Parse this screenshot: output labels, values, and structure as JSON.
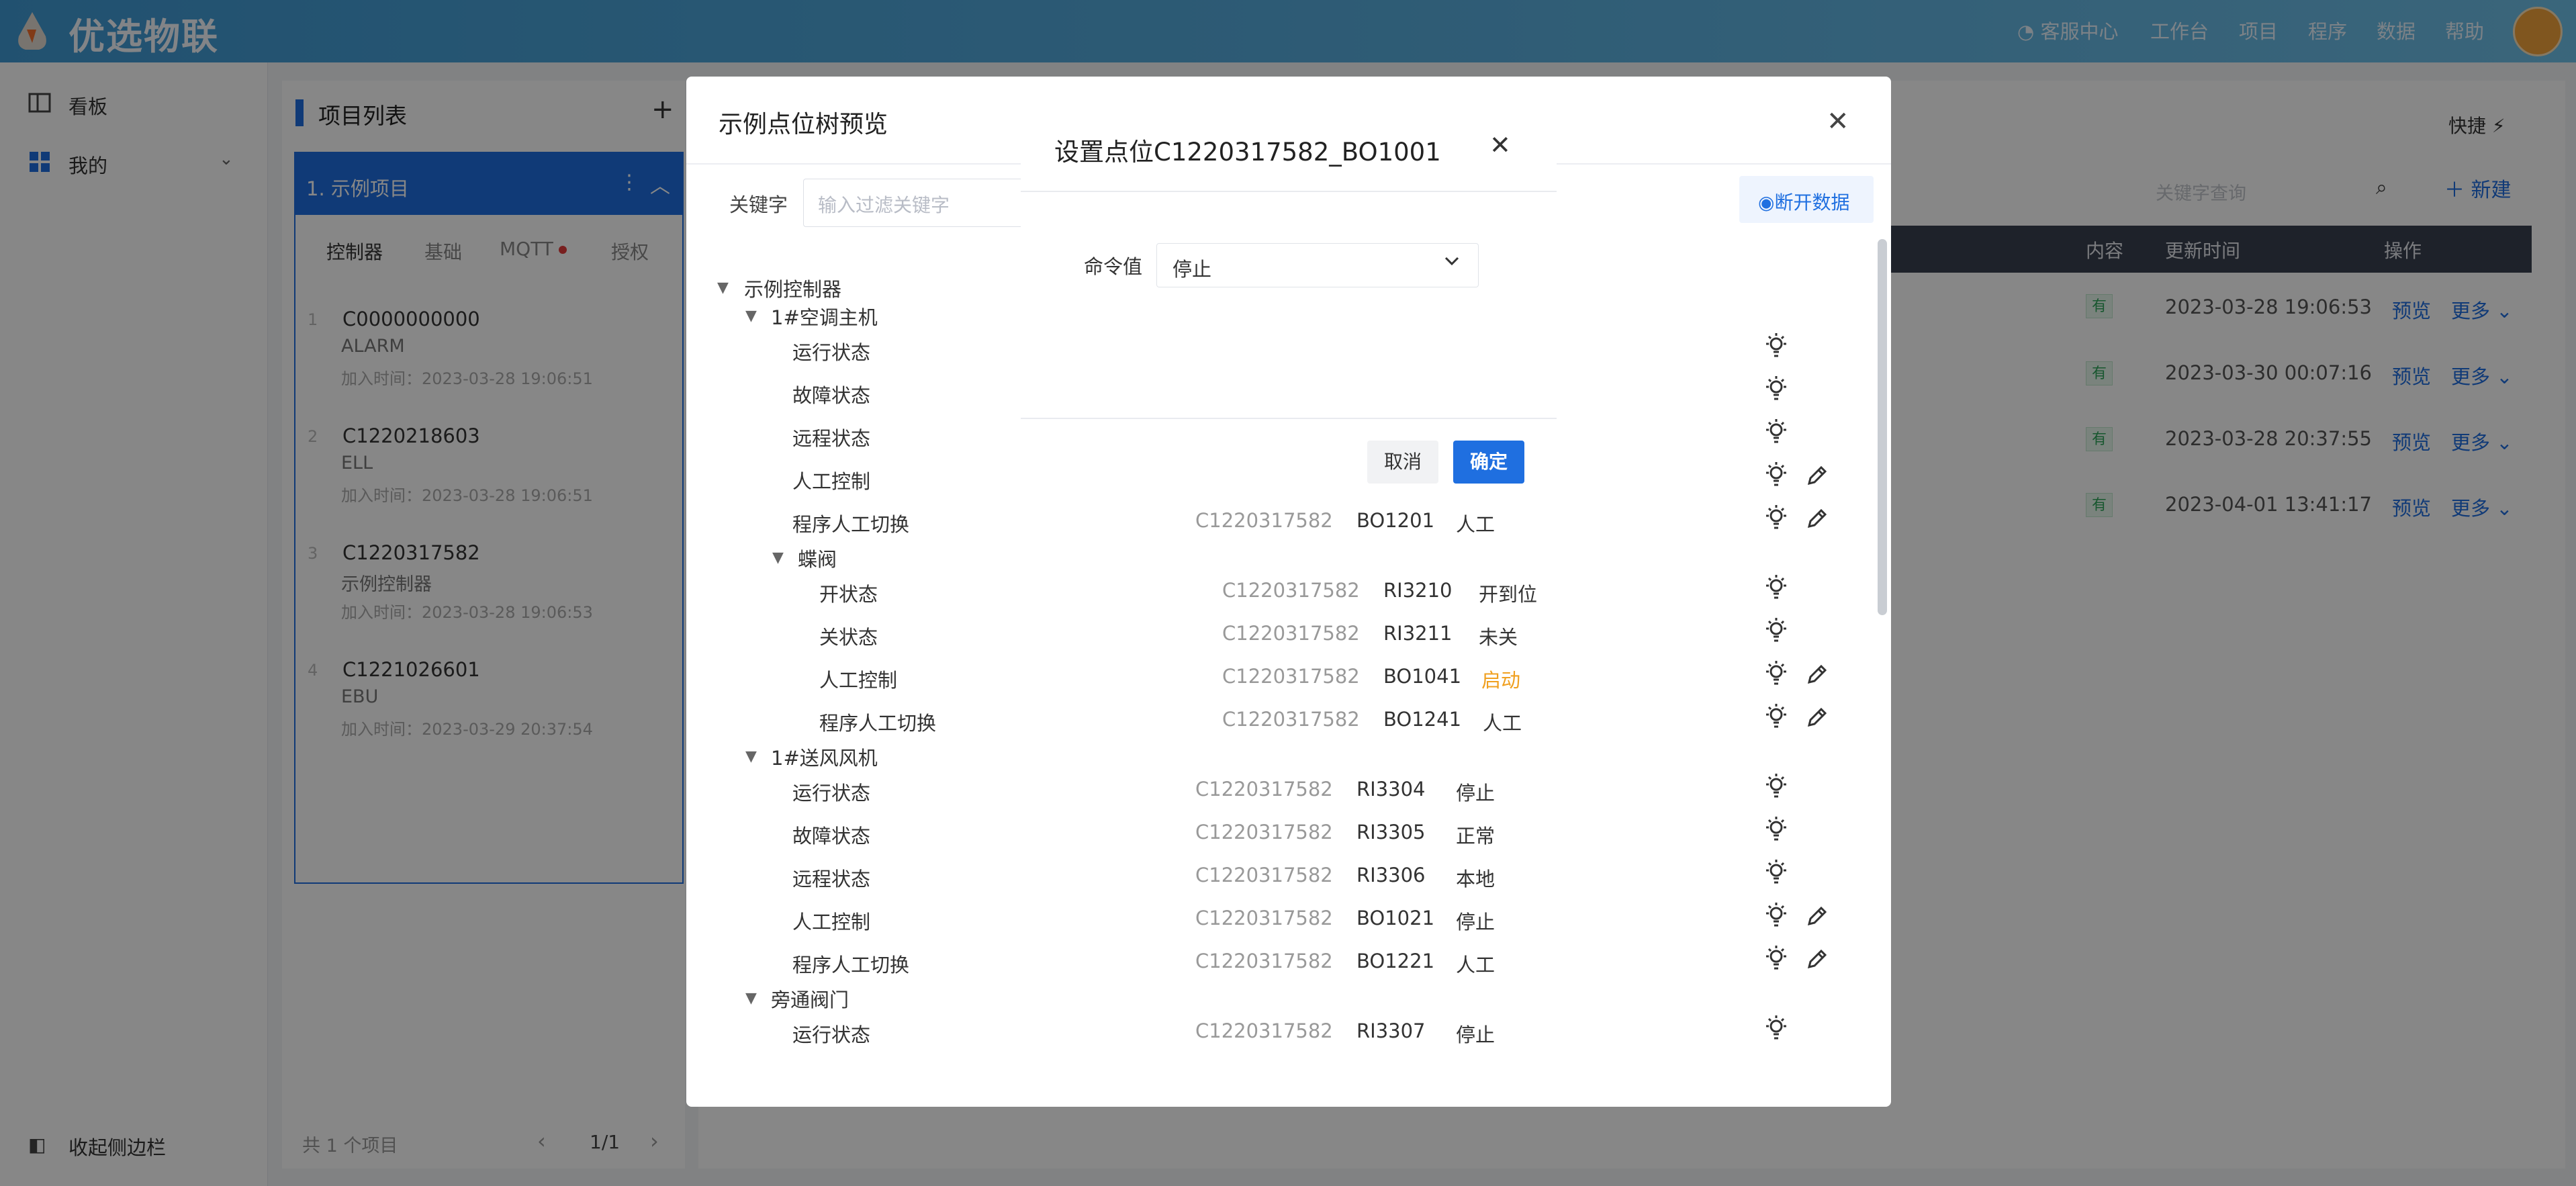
{
  "brand": {
    "name": "优选物联"
  },
  "nav": {
    "items": [
      "客服中心",
      "工作台",
      "项目",
      "程序",
      "数据",
      "帮助"
    ]
  },
  "sidebar": {
    "items": [
      "看板",
      "我的"
    ],
    "collapse_label": "收起侧边栏"
  },
  "project_list": {
    "title": "项目列表",
    "active_project": "1. 示例项目",
    "tabs": [
      "控制器",
      "基础",
      "MQTT",
      "授权"
    ],
    "items": [
      {
        "no": "1",
        "code": "C0000000000",
        "sub": "ALARM",
        "time": "加入时间：2023-03-28 19:06:51"
      },
      {
        "no": "2",
        "code": "C1220218603",
        "sub": "ELL",
        "time": "加入时间：2023-03-28 19:06:51"
      },
      {
        "no": "3",
        "code": "C1220317582",
        "sub": "示例控制器",
        "time": "加入时间：2023-03-28 19:06:53"
      },
      {
        "no": "4",
        "code": "C1221026601",
        "sub": "EBU",
        "time": "加入时间：2023-03-29 20:37:54"
      }
    ],
    "footer_count": "共 1 个项目",
    "pagination": "1/1"
  },
  "main": {
    "quick_label": "快捷",
    "search_placeholder": "关键字查询",
    "new_label": "新建",
    "headers": [
      "内容",
      "更新时间",
      "操作"
    ],
    "rows": [
      {
        "tag": "有",
        "time": "2023-03-28 19:06:53",
        "preview": "预览",
        "more": "更多"
      },
      {
        "tag": "有",
        "time": "2023-03-30 00:07:16",
        "preview": "预览",
        "more": "更多"
      },
      {
        "tag": "有",
        "time": "2023-03-28 20:37:55",
        "preview": "预览",
        "more": "更多"
      },
      {
        "tag": "有",
        "time": "2023-04-01 13:41:17",
        "preview": "预览",
        "more": "更多"
      }
    ]
  },
  "tree_dialog": {
    "title": "示例点位树预览",
    "keyword_label": "关键字",
    "keyword_placeholder": "输入过滤关键字",
    "disconnect_label": "断开数据",
    "root": "示例控制器",
    "group1": "1#空调主机",
    "group1_rows": [
      {
        "name": "运行状态"
      },
      {
        "name": "故障状态"
      },
      {
        "name": "远程状态"
      },
      {
        "name": "人工控制"
      },
      {
        "name": "程序人工切换",
        "code": "C1220317582",
        "pt": "BO1201",
        "val": "人工"
      }
    ],
    "sub_group": "蝶阀",
    "sub_rows": [
      {
        "name": "开状态",
        "code": "C1220317582",
        "pt": "RI3210",
        "val": "开到位"
      },
      {
        "name": "关状态",
        "code": "C1220317582",
        "pt": "RI3211",
        "val": "未关"
      },
      {
        "name": "人工控制",
        "code": "C1220317582",
        "pt": "BO1041",
        "val": "启动"
      },
      {
        "name": "程序人工切换",
        "code": "C1220317582",
        "pt": "BO1241",
        "val": "人工"
      }
    ],
    "group2": "1#送风风机",
    "group2_rows": [
      {
        "name": "运行状态",
        "code": "C1220317582",
        "pt": "RI3304",
        "val": "停止"
      },
      {
        "name": "故障状态",
        "code": "C1220317582",
        "pt": "RI3305",
        "val": "正常"
      },
      {
        "name": "远程状态",
        "code": "C1220317582",
        "pt": "RI3306",
        "val": "本地"
      },
      {
        "name": "人工控制",
        "code": "C1220317582",
        "pt": "BO1021",
        "val": "停止"
      },
      {
        "name": "程序人工切换",
        "code": "C1220317582",
        "pt": "BO1221",
        "val": "人工"
      }
    ],
    "group3": "旁通阀门",
    "group3_rows": [
      {
        "name": "运行状态",
        "code": "C1220317582",
        "pt": "RI3307",
        "val": "停止"
      }
    ]
  },
  "set_dialog": {
    "title": "设置点位C1220317582_BO1001",
    "field_label": "命令值",
    "field_value": "停止",
    "cancel_label": "取消",
    "ok_label": "确定"
  },
  "colors": {
    "accent": "#1f6fe0",
    "warn": "#f0a020",
    "header": "#3f9ad4"
  }
}
